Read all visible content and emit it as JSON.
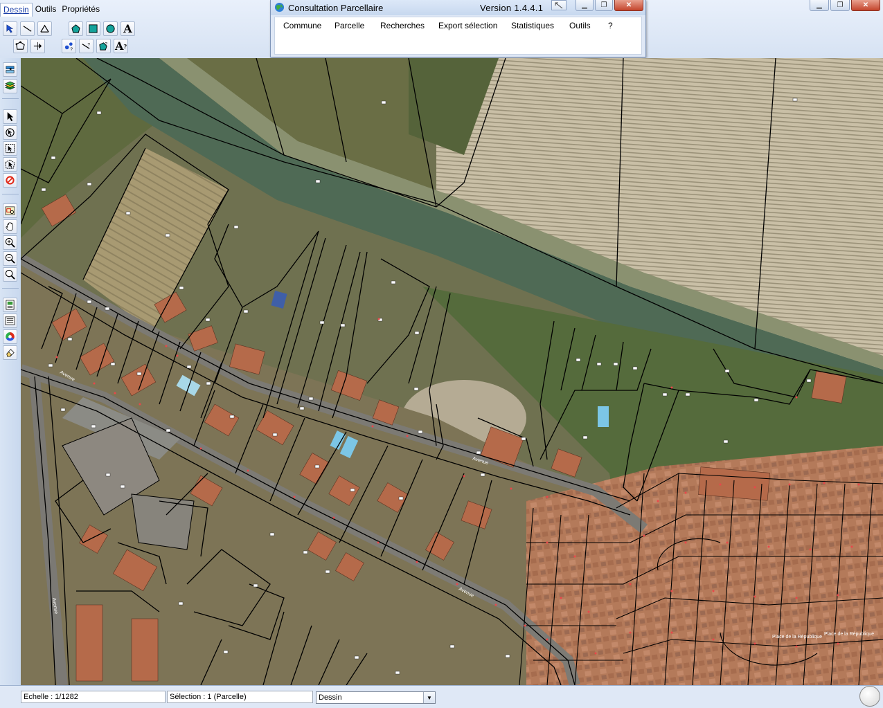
{
  "app": {
    "menu": [
      {
        "label": "Dessin",
        "active": true
      },
      {
        "label": "Outils",
        "active": false
      },
      {
        "label": "Propriétés",
        "active": false
      }
    ]
  },
  "consultation": {
    "title": "Consultation Parcellaire",
    "version": "Version 1.4.4.1",
    "menu": [
      "Commune",
      "Parcelle",
      "Recherches",
      "Export sélection",
      "Statistiques",
      "Outils",
      "?"
    ]
  },
  "map": {
    "street_labels": [
      "Avenue",
      "Avenue",
      "Avenue",
      "Avenue"
    ],
    "place_labels": [
      "Place de la République",
      "Place de la République"
    ]
  },
  "status": {
    "scale": "Echelle : 1/1282",
    "selection": "Sélection : 1 (Parcelle)",
    "mode": "Dessin"
  },
  "icons": {
    "draw_tools": [
      "select-point-icon",
      "line-icon",
      "polyline-icon",
      "polygon-icon",
      "rectangle-icon",
      "circle-icon",
      "text-icon",
      "polygon-add-icon",
      "snap-icon",
      "edit-points-icon",
      "edit-line-icon",
      "edit-polygon-icon",
      "edit-text-icon"
    ],
    "left_tools": [
      "layers-icon",
      "layer-stack-icon",
      "pointer-icon",
      "info-icon",
      "select-rect-icon",
      "select-poly-icon",
      "no-select-icon",
      "zoom-window-icon",
      "pan-hand-icon",
      "zoom-in-icon",
      "zoom-out-icon",
      "zoom-full-icon",
      "print-icon",
      "legend-icon",
      "color-wheel-icon",
      "clear-icon"
    ]
  }
}
